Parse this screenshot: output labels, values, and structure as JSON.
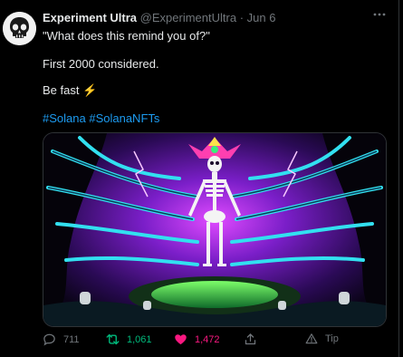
{
  "tweet": {
    "display_name": "Experiment Ultra",
    "handle": "@ExperimentUltra",
    "separator": "·",
    "date": "Jun 6",
    "line1": "\"What does this remind you of?\"",
    "line2": "First 2000 considered.",
    "line3": "Be fast",
    "line3_emoji": "⚡",
    "hashtags": [
      "#Solana",
      "#SolanaNFTs"
    ]
  },
  "actions": {
    "reply_count": "711",
    "retweet_count": "1,061",
    "like_count": "1,472",
    "tip_label": "Tip"
  },
  "colors": {
    "background": "#000000",
    "text": "#e7e9ea",
    "muted": "#71767b",
    "link": "#1d9bf0",
    "retweet_green": "#00ba7c",
    "like_pink": "#f91880"
  },
  "icons": {
    "avatar": "skull-avatar",
    "more": "more-dots-icon",
    "reply": "reply-icon",
    "retweet": "retweet-icon",
    "like": "heart-icon",
    "share": "share-icon",
    "tip": "tip-icon"
  }
}
